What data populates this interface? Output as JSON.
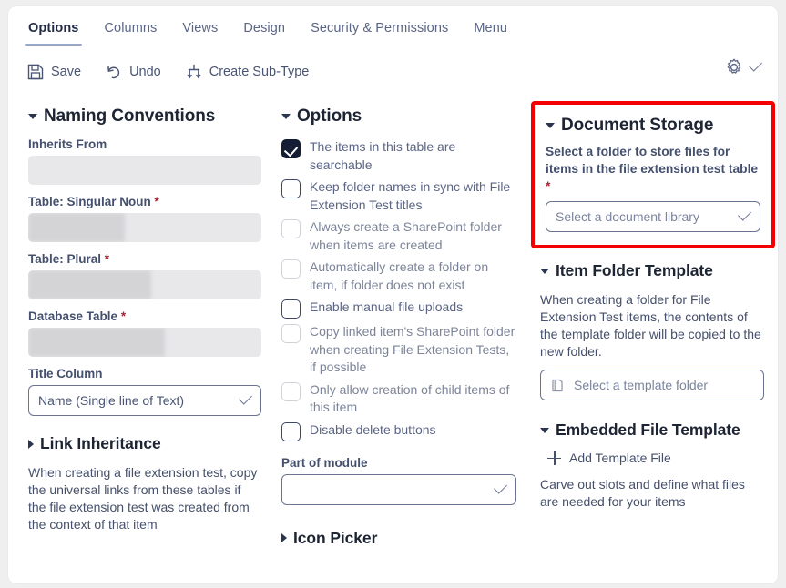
{
  "tabs": [
    {
      "label": "Options",
      "active": true
    },
    {
      "label": "Columns",
      "active": false
    },
    {
      "label": "Views",
      "active": false
    },
    {
      "label": "Design",
      "active": false
    },
    {
      "label": "Security & Permissions",
      "active": false
    },
    {
      "label": "Menu",
      "active": false
    }
  ],
  "toolbar": {
    "save_label": "Save",
    "undo_label": "Undo",
    "create_subtype_label": "Create Sub-Type"
  },
  "naming": {
    "title": "Naming Conventions",
    "inherits_from_label": "Inherits From",
    "singular_label": "Table: Singular Noun",
    "plural_label": "Table: Plural",
    "database_label": "Database Table",
    "title_column_label": "Title Column",
    "title_column_value": "Name (Single line of Text)",
    "required_mark": "*"
  },
  "link_inheritance": {
    "title": "Link Inheritance",
    "description": "When creating a file extension test, copy the universal links from these tables if the file extension test was created from the context of that item"
  },
  "options": {
    "title": "Options",
    "checkboxes": [
      {
        "label": "The items in this table are searchable",
        "checked": true,
        "enabled": true
      },
      {
        "label": "Keep folder names in sync with File Extension Test titles",
        "checked": false,
        "enabled": true
      },
      {
        "label": "Always create a SharePoint folder when items are created",
        "checked": false,
        "enabled": false
      },
      {
        "label": "Automatically create a folder on item, if folder does not exist",
        "checked": false,
        "enabled": false
      },
      {
        "label": "Enable manual file uploads",
        "checked": false,
        "enabled": true
      },
      {
        "label": "Copy linked item's SharePoint folder when creating File Extension Tests, if possible",
        "checked": false,
        "enabled": false
      },
      {
        "label": "Only allow creation of child items of this item",
        "checked": false,
        "enabled": false
      },
      {
        "label": "Disable delete buttons",
        "checked": false,
        "enabled": true
      }
    ],
    "part_of_module_label": "Part of module",
    "part_of_module_value": ""
  },
  "icon_picker": {
    "title": "Icon Picker"
  },
  "document_storage": {
    "title": "Document Storage",
    "note": "Select a folder to store files for items in the file extension test table",
    "required_mark": "*",
    "select_placeholder": "Select a document library",
    "highlight_color": "#f40000"
  },
  "item_folder_template": {
    "title": "Item Folder Template",
    "description": "When creating a folder for File Extension Test items, the contents of the template folder will be copied to the new folder.",
    "button_label": "Select a template folder"
  },
  "embedded_file_template": {
    "title": "Embedded File Template",
    "add_label": "Add Template File",
    "description": "Carve out slots and define what files are needed for your items"
  }
}
